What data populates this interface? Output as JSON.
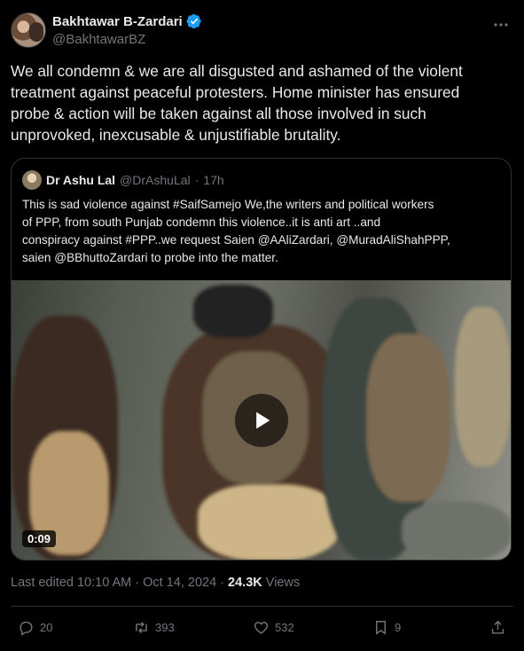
{
  "author": {
    "name": "Bakhtawar B-Zardari",
    "handle": "@BakhtawarBZ"
  },
  "icons": {
    "verified": "verified-badge-icon",
    "more": "more-icon",
    "play": "play-icon",
    "reply": "reply-icon",
    "retweet": "retweet-icon",
    "like": "like-icon",
    "bookmark": "bookmark-icon",
    "share": "share-icon"
  },
  "colors": {
    "background": "#000000",
    "text": "#e7e9ea",
    "secondary": "#71767b",
    "verified": "#1d9bf0",
    "border": "#2f3336"
  },
  "tweet": {
    "text": "We all condemn & we are all disgusted and ashamed of the violent\ntreatment against peaceful protesters. Home minister has ensured\nprobe & action will be taken against all those involved in such\nunprovoked, inexcusable & unjustifiable brutality."
  },
  "quote": {
    "name": "Dr Ashu Lal",
    "handle": "@DrAshuLal",
    "separator": "·",
    "time": "17h",
    "text": "This is sad violence against #SaifSamejo We,the writers and political workers\nof PPP,  from south Punjab condemn this violence..it is anti art ..and\nconspiracy against #PPP..we request Saien @AAliZardari, @MuradAliShahPPP,\nsaien @BBhuttoZardari  to probe into the matter.",
    "video": {
      "duration": "0:09"
    }
  },
  "meta": {
    "edited": "Last edited 10:10 AM · Oct 14, 2024 · ",
    "views_count": "24.3K",
    "views_label": " Views"
  },
  "actions": {
    "replies": "20",
    "retweets": "393",
    "likes": "532",
    "bookmarks": "9"
  }
}
